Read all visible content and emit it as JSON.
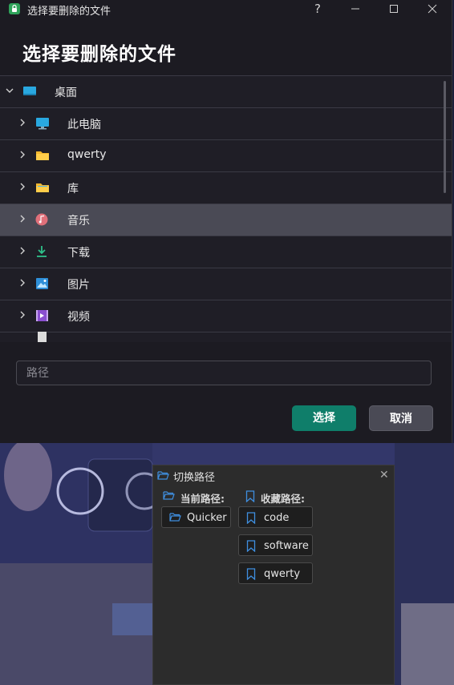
{
  "window": {
    "title": "选择要删除的文件",
    "help": "?",
    "minimize": "—",
    "maximize": "☐",
    "close": "✕"
  },
  "dialog": {
    "heading": "选择要删除的文件"
  },
  "tree": {
    "items": [
      {
        "label": "桌面",
        "icon": "desktop-icon",
        "expanded": true
      },
      {
        "label": "此电脑",
        "icon": "computer-icon"
      },
      {
        "label": "qwerty",
        "icon": "folder-icon"
      },
      {
        "label": "库",
        "icon": "folder-icon"
      },
      {
        "label": "音乐",
        "icon": "music-icon",
        "selected": true
      },
      {
        "label": "下载",
        "icon": "download-icon"
      },
      {
        "label": "图片",
        "icon": "picture-icon"
      },
      {
        "label": "视频",
        "icon": "video-icon"
      }
    ]
  },
  "path": {
    "placeholder": "路径",
    "value": ""
  },
  "buttons": {
    "select": "选择",
    "cancel": "取消"
  },
  "switch_panel": {
    "title": "切换路径",
    "close": "✕",
    "current_label": "当前路径:",
    "favorites_label": "收藏路径:",
    "current": [
      "Quicker"
    ],
    "favorites": [
      "code",
      "software",
      "qwerty"
    ]
  },
  "colors": {
    "accent": "#0f7e6a",
    "selected_row": "#4a4a55",
    "bookmark": "#3f8fe0"
  }
}
